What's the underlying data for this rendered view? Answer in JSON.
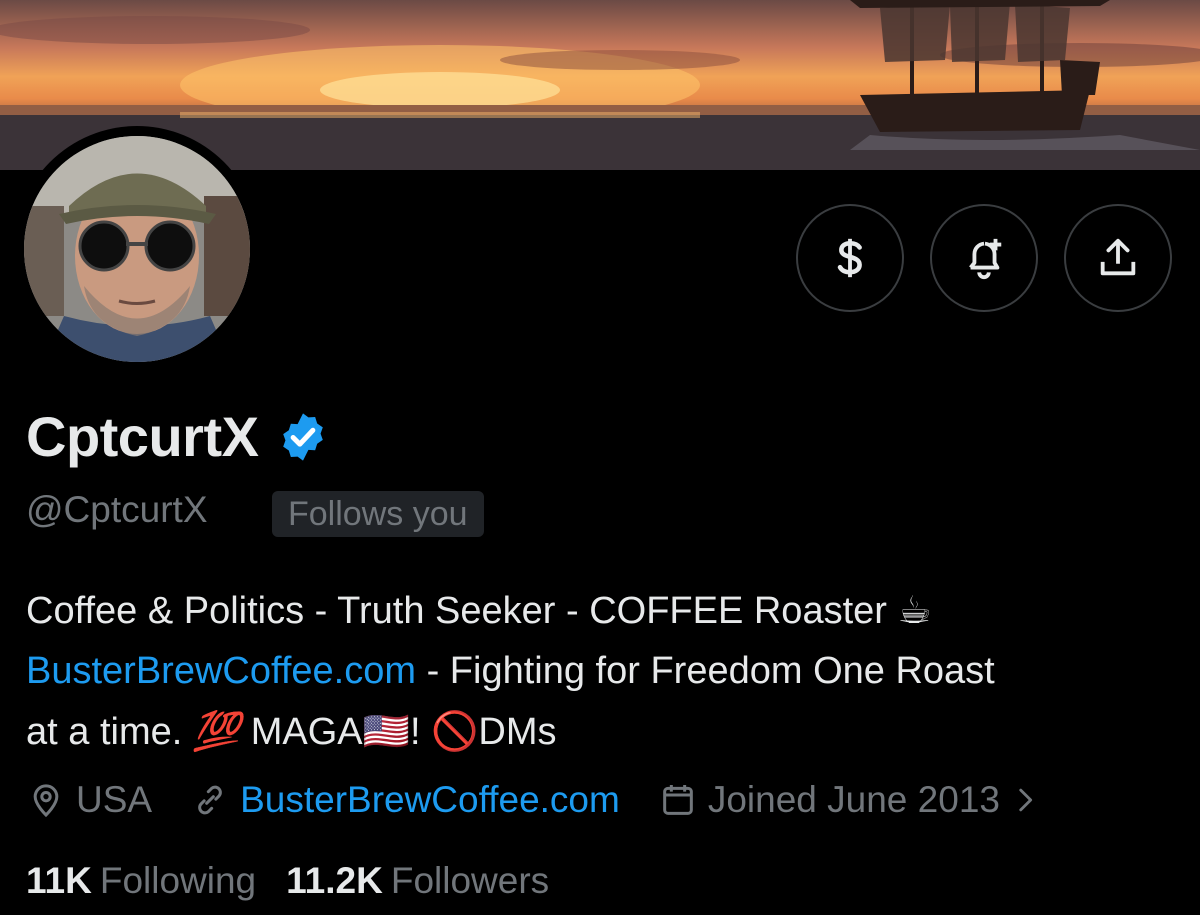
{
  "profile": {
    "display_name": "CptcurtX",
    "handle": "@CptcurtX",
    "follows_you_badge": "Follows you",
    "bio": {
      "line1": "Coffee & Politics - Truth Seeker - COFFEE Roaster",
      "line1_emoji": "☕",
      "link": "BusterBrewCoffee.com",
      "line2_rest": " - Fighting for Freedom One Roast",
      "line3_a": "at a time. ",
      "hundred_emoji": "💯",
      "line3_b": " MAGA",
      "flag_emoji": "🇺🇸",
      "line3_c": "! ",
      "prohibited_emoji": "🚫",
      "line3_d": "DMs"
    },
    "location": "USA",
    "website": "BusterBrewCoffee.com",
    "joined": "Joined June 2013"
  },
  "stats": {
    "following_count": "11K",
    "following_label": "Following",
    "followers_count": "11.2K",
    "followers_label": "Followers"
  },
  "actions": [
    {
      "icon": "dollar-icon"
    },
    {
      "icon": "bell-plus-icon"
    },
    {
      "icon": "share-icon"
    }
  ],
  "colors": {
    "background": "#000000",
    "text_primary": "#e7e9ea",
    "text_secondary": "#71767b",
    "link": "#1d9bf0",
    "verified": "#1d9bf0"
  }
}
